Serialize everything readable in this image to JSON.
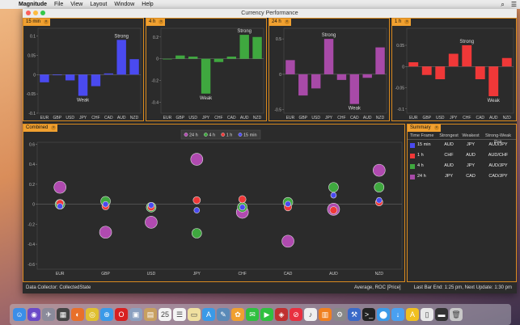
{
  "menubar": {
    "app_name": "Magnitude",
    "items": [
      "File",
      "View",
      "Layout",
      "Window",
      "Help"
    ]
  },
  "window": {
    "title": "Currency Performance"
  },
  "tabs": {
    "p15": "15 min",
    "p4": "4 h",
    "p24": "24 h",
    "p1": "1 h",
    "combined": "Combined",
    "summary": "Summary"
  },
  "labels": {
    "strong": "Strong",
    "weak": "Weak"
  },
  "chart_data": [
    {
      "type": "bar",
      "title": "15 min",
      "color": "#4a4af0",
      "categories": [
        "EUR",
        "GBP",
        "USD",
        "JPY",
        "CHF",
        "CAD",
        "AUD",
        "NZD"
      ],
      "values": [
        -0.02,
        0.0,
        -0.015,
        -0.055,
        -0.03,
        0.003,
        0.09,
        0.04
      ],
      "ylim": [
        -0.1,
        0.12
      ],
      "yticks": [
        -0.1,
        -0.05,
        0,
        0.05,
        0.1
      ],
      "ytick_labels": [
        "-0.1",
        "-0.05",
        "0",
        "0.05",
        "0.1"
      ],
      "strong": "AUD",
      "weak": "JPY"
    },
    {
      "type": "bar",
      "title": "4 h",
      "color": "#3fa83f",
      "categories": [
        "EUR",
        "GBP",
        "USD",
        "JPY",
        "CHF",
        "CAD",
        "AUD",
        "NZD"
      ],
      "values": [
        0.0,
        0.03,
        0.02,
        -0.32,
        -0.03,
        0.02,
        0.22,
        0.2
      ],
      "ylim": [
        -0.5,
        0.28
      ],
      "yticks": [
        -0.4,
        -0.2,
        0,
        0.2
      ],
      "ytick_labels": [
        "-0.4",
        "-0.2",
        "0",
        "0.2"
      ],
      "strong": "AUD",
      "weak": "JPY"
    },
    {
      "type": "bar",
      "title": "24 h",
      "color": "#a84aa8",
      "categories": [
        "EUR",
        "GBP",
        "USD",
        "JPY",
        "CHF",
        "CAD",
        "AUD",
        "NZD"
      ],
      "values": [
        0.2,
        -0.3,
        -0.2,
        0.5,
        -0.08,
        -0.42,
        -0.05,
        0.38
      ],
      "ylim": [
        -0.55,
        0.65
      ],
      "yticks": [
        -0.5,
        0,
        0.5
      ],
      "ytick_labels": [
        "-0.5",
        "0",
        "0.5"
      ],
      "strong": "JPY",
      "weak": "CAD"
    },
    {
      "type": "bar",
      "title": "1 h",
      "color": "#f03838",
      "categories": [
        "EUR",
        "GBP",
        "USD",
        "JPY",
        "CHF",
        "CAD",
        "AUD",
        "NZD"
      ],
      "values": [
        0.01,
        -0.02,
        -0.03,
        0.03,
        0.05,
        -0.03,
        -0.07,
        0.02
      ],
      "ylim": [
        -0.11,
        0.09
      ],
      "yticks": [
        -0.1,
        -0.05,
        0,
        0.05
      ],
      "ytick_labels": [
        "-0.1",
        "-0.05",
        "0",
        "0.05"
      ],
      "strong": "CHF",
      "weak": "AUD"
    },
    {
      "type": "scatter",
      "title": "Combined",
      "categories": [
        "EUR",
        "GBP",
        "USD",
        "JPY",
        "CHF",
        "CAD",
        "AUD",
        "NZD"
      ],
      "ylim": [
        -0.65,
        0.62
      ],
      "yticks": [
        -0.6,
        -0.4,
        -0.2,
        0,
        0.2,
        0.4,
        0.6
      ],
      "ytick_labels": [
        "-0.6",
        "-0.4",
        "-0.2",
        "0",
        "0.2",
        "0.4",
        "0.6"
      ],
      "legend": "top-center",
      "series": [
        {
          "name": "24 h",
          "color": "#b04ab0",
          "size": 7.5,
          "values": [
            0.17,
            -0.28,
            -0.18,
            0.45,
            -0.08,
            -0.37,
            -0.05,
            0.34
          ]
        },
        {
          "name": "4 h",
          "color": "#3fa83f",
          "size": 6,
          "values": [
            0.0,
            0.03,
            -0.03,
            -0.29,
            -0.03,
            0.02,
            0.17,
            0.17
          ]
        },
        {
          "name": "1 h",
          "color": "#f03838",
          "size": 4.5,
          "values": [
            0.01,
            -0.02,
            -0.03,
            0.04,
            0.05,
            -0.03,
            -0.06,
            0.02
          ]
        },
        {
          "name": "15 min",
          "color": "#4a4af0",
          "size": 3.5,
          "values": [
            -0.02,
            0.0,
            -0.01,
            -0.06,
            -0.03,
            0.003,
            0.09,
            0.04
          ]
        }
      ]
    }
  ],
  "summary": {
    "headers": [
      "Time Frame",
      "Strongest",
      "Weakest",
      "Strong-Weak Pair"
    ],
    "rows": [
      {
        "frame": "15 min",
        "strongest": "AUD",
        "weakest": "JPY",
        "pair": "AUD/JPY",
        "color": "#4a4af0"
      },
      {
        "frame": "1 h",
        "strongest": "CHF",
        "weakest": "AUD",
        "pair": "AUD/CHF",
        "color": "#f03838"
      },
      {
        "frame": "4 h",
        "strongest": "AUD",
        "weakest": "JPY",
        "pair": "AUD/JPY",
        "color": "#3fa83f"
      },
      {
        "frame": "24 h",
        "strongest": "JPY",
        "weakest": "CAD",
        "pair": "CAD/JPY",
        "color": "#a84aa8"
      }
    ]
  },
  "status": {
    "left": "Data Collector: CollectedState",
    "middle": "Average, ROC [Price]",
    "right": "Last Bar End: 1:25 pm, Next Update: 1:30 pm"
  },
  "dock": [
    {
      "name": "finder",
      "color": "#3a8ee8",
      "glyph": "☺"
    },
    {
      "name": "siri",
      "color": "#6a4ac8",
      "glyph": "◉"
    },
    {
      "name": "launchpad",
      "color": "#8a8a9a",
      "glyph": "✈"
    },
    {
      "name": "mission-control",
      "color": "#444",
      "glyph": "▦"
    },
    {
      "name": "firefox",
      "color": "#e8702a",
      "glyph": "◐"
    },
    {
      "name": "chrome",
      "color": "#e0c030",
      "glyph": "◎"
    },
    {
      "name": "safari",
      "color": "#3a9ae8",
      "glyph": "⊕"
    },
    {
      "name": "opera",
      "color": "#d82020",
      "glyph": "O"
    },
    {
      "name": "preview",
      "color": "#8aa0c0",
      "glyph": "▣"
    },
    {
      "name": "notes",
      "color": "#c8a060",
      "glyph": "▤"
    },
    {
      "name": "calendar",
      "color": "#f4f4f4",
      "glyph": "25"
    },
    {
      "name": "reminders",
      "color": "#f4f4f4",
      "glyph": "☰"
    },
    {
      "name": "stickies",
      "color": "#f0e0a0",
      "glyph": "▭"
    },
    {
      "name": "app-store",
      "color": "#3a9ae8",
      "glyph": "A"
    },
    {
      "name": "utilities",
      "color": "#5a8ab8",
      "glyph": "✎"
    },
    {
      "name": "photos",
      "color": "#f0a030",
      "glyph": "✿"
    },
    {
      "name": "messages",
      "color": "#30c040",
      "glyph": "✉"
    },
    {
      "name": "facetime",
      "color": "#30c040",
      "glyph": "▶"
    },
    {
      "name": "photo-booth",
      "color": "#c03030",
      "glyph": "◈"
    },
    {
      "name": "news",
      "color": "#e83040",
      "glyph": "⊘"
    },
    {
      "name": "music",
      "color": "#f0f0f0",
      "glyph": "♪"
    },
    {
      "name": "books",
      "color": "#f08020",
      "glyph": "▥"
    },
    {
      "name": "system-preferences",
      "color": "#888",
      "glyph": "⚙"
    },
    {
      "name": "xcode",
      "color": "#3a6ac8",
      "glyph": "⚒"
    },
    {
      "name": "terminal",
      "color": "#222",
      "glyph": ">_"
    },
    {
      "name": "maps",
      "color": "#3a9ae8",
      "glyph": "⬤"
    },
    {
      "name": "downloads",
      "color": "#4aa0f0",
      "glyph": "↓"
    },
    {
      "name": "fontlab",
      "color": "#f0c020",
      "glyph": "A"
    },
    {
      "name": "file",
      "color": "#e8e8e8",
      "glyph": "▯"
    },
    {
      "name": "screen",
      "color": "#333",
      "glyph": "▬"
    },
    {
      "name": "trash",
      "color": "#c8c8c8",
      "glyph": "🗑"
    }
  ]
}
